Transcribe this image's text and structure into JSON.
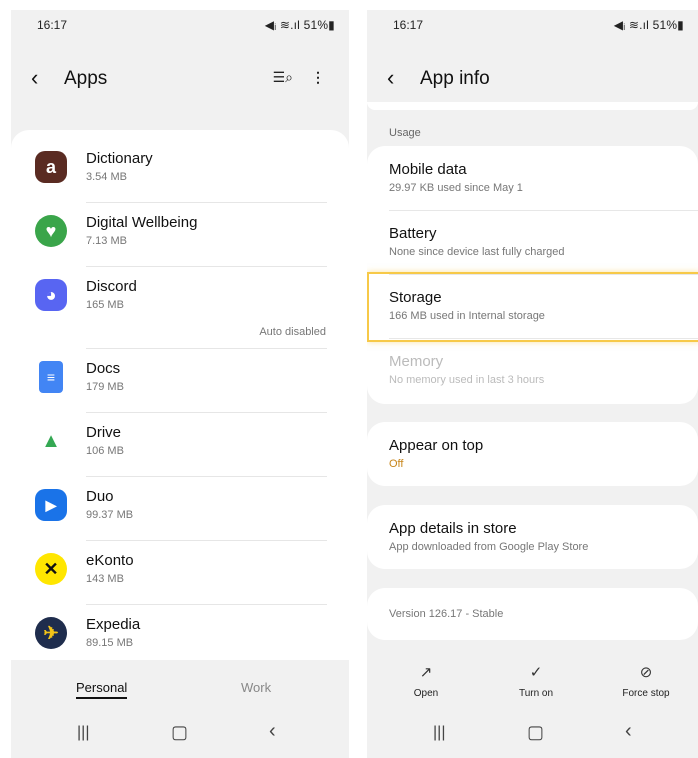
{
  "left": {
    "status": {
      "time": "16:17",
      "icons": "◀ᵢ ≋.ıl 51%▮"
    },
    "header": {
      "title": "Apps"
    },
    "apps": [
      {
        "name": "Dictionary",
        "size": "3.54 MB",
        "note": "",
        "icon": "dictionary-icon",
        "color": "#5a2b22",
        "glyph": "a"
      },
      {
        "name": "Digital Wellbeing",
        "size": "7.13 MB",
        "note": "",
        "icon": "digital-wellbeing-icon",
        "color": "#3aa54a",
        "glyph": "♥"
      },
      {
        "name": "Discord",
        "size": "165 MB",
        "note": "Auto disabled",
        "icon": "discord-icon",
        "color": "#5865f2",
        "glyph": "◕"
      },
      {
        "name": "Docs",
        "size": "179 MB",
        "note": "",
        "icon": "docs-icon",
        "color": "#4285f4",
        "glyph": "≡"
      },
      {
        "name": "Drive",
        "size": "106 MB",
        "note": "",
        "icon": "drive-icon",
        "color": "#ffffff",
        "glyph": "▲"
      },
      {
        "name": "Duo",
        "size": "99.37 MB",
        "note": "",
        "icon": "duo-icon",
        "color": "#1a73e8",
        "glyph": "▶"
      },
      {
        "name": "eKonto",
        "size": "143 MB",
        "note": "",
        "icon": "ekonto-icon",
        "color": "#ffe600",
        "glyph": "✕"
      },
      {
        "name": "Expedia",
        "size": "89.15 MB",
        "note": "",
        "icon": "expedia-icon",
        "color": "#1f2d4d",
        "glyph": "✈"
      }
    ],
    "tabs": {
      "personal": "Personal",
      "work": "Work"
    }
  },
  "right": {
    "status": {
      "time": "16:17",
      "icons": "◀ᵢ ≋.ıl 51%▮"
    },
    "header": {
      "title": "App info"
    },
    "usage_label": "Usage",
    "usage": [
      {
        "title": "Mobile data",
        "sub": "29.97 KB used since May 1"
      },
      {
        "title": "Battery",
        "sub": "None since device last fully charged"
      },
      {
        "title": "Storage",
        "sub": "166 MB used in Internal storage"
      },
      {
        "title": "Memory",
        "sub": "No memory used in last 3 hours"
      }
    ],
    "appear": {
      "title": "Appear on top",
      "sub": "Off"
    },
    "store": {
      "title": "App details in store",
      "sub": "App downloaded from Google Play Store"
    },
    "version": "Version 126.17 - Stable",
    "actions": {
      "open": "Open",
      "turn_on": "Turn on",
      "force_stop": "Force stop"
    }
  },
  "colors": {
    "highlight": "#f7c948",
    "accent_off": "#c7851a"
  }
}
